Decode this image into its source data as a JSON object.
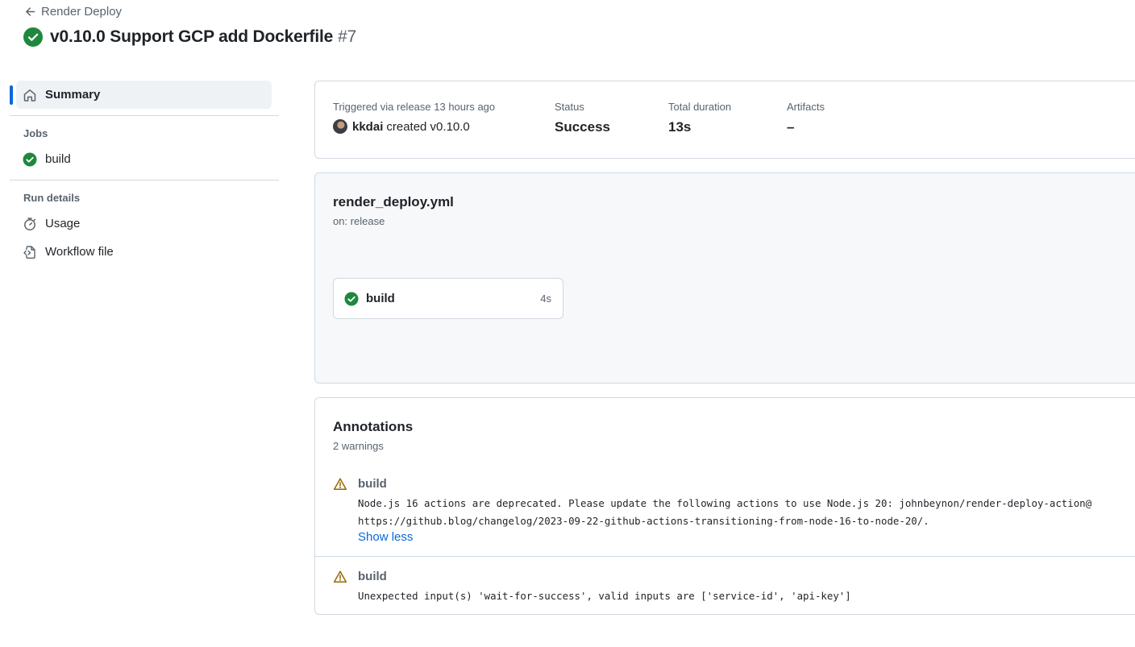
{
  "header": {
    "back_label": "Render Deploy",
    "title": "v0.10.0 Support GCP add Dockerfile",
    "run_number": "#7"
  },
  "sidebar": {
    "summary_label": "Summary",
    "jobs_heading": "Jobs",
    "jobs": [
      {
        "label": "build"
      }
    ],
    "run_details_heading": "Run details",
    "usage_label": "Usage",
    "workflow_file_label": "Workflow file"
  },
  "summary": {
    "trigger_label": "Triggered via release 13 hours ago",
    "trigger_user": "kkdai",
    "trigger_action": "created v0.10.0",
    "status_label": "Status",
    "status_value": "Success",
    "duration_label": "Total duration",
    "duration_value": "13s",
    "artifacts_label": "Artifacts",
    "artifacts_value": "–"
  },
  "workflow": {
    "file_name": "render_deploy.yml",
    "trigger": "on: release",
    "job_name": "build",
    "job_duration": "4s"
  },
  "annotations": {
    "title": "Annotations",
    "count": "2 warnings",
    "items": [
      {
        "job": "build",
        "lines": [
          "Node.js 16 actions are deprecated. Please update the following actions to use Node.js 20: johnbeynon/render-deploy-action@",
          "https://github.blog/changelog/2023-09-22-github-actions-transitioning-from-node-16-to-node-20/."
        ],
        "toggle_label": "Show less"
      },
      {
        "job": "build",
        "lines": [
          "Unexpected input(s) 'wait-for-success', valid inputs are ['service-id', 'api-key']"
        ]
      }
    ]
  },
  "colors": {
    "success": "#1f883d",
    "warning": "#9a6700",
    "link": "#0969da",
    "active_indicator": "#0969da"
  }
}
